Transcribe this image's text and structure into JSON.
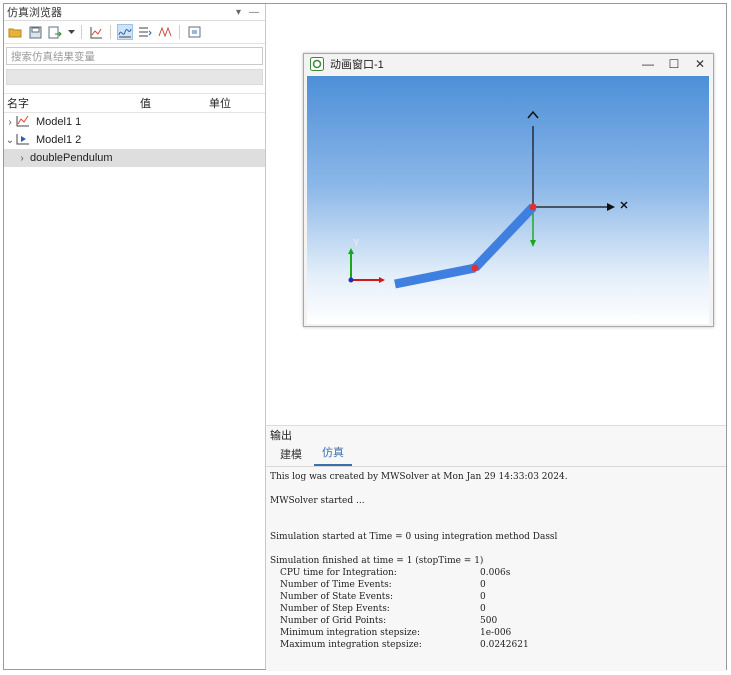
{
  "browser": {
    "title": "仿真浏览器",
    "title_controls": [
      "▾",
      "—"
    ],
    "search_placeholder": "搜索仿真结果变量",
    "columns": [
      "名字",
      "值",
      "单位"
    ],
    "tree": [
      {
        "expander": "›",
        "label": "Model1 1"
      },
      {
        "expander": "⌄",
        "label": "Model1 2"
      },
      {
        "expander": "›",
        "label": "doublePendulum"
      }
    ]
  },
  "anim_window": {
    "title": "动画窗口-1",
    "controls": [
      "—",
      "☐",
      "✕"
    ],
    "axis_labels": {
      "x": "X",
      "y": "Y"
    },
    "colors": {
      "link": "#3f7fe0",
      "joint": "#e03030",
      "x_axis": "#d01818",
      "y_axis": "#18a818"
    }
  },
  "output": {
    "title": "输出",
    "tabs": [
      "建模",
      "仿真"
    ],
    "active_tab": "仿真",
    "log_lines": {
      "created": "This log was created by MWSolver at Mon Jan 29 14:33:03 2024.",
      "started": "MWSolver started ...",
      "sim_start": "Simulation started at Time = 0 using integration method Dassl",
      "sim_finish": "Simulation finished at time = 1 (stopTime = 1)"
    },
    "stats": [
      {
        "key": "CPU time for Integration:",
        "value": "0.006s"
      },
      {
        "key": "Number of Time Events:",
        "value": "0"
      },
      {
        "key": "Number of State Events:",
        "value": "0"
      },
      {
        "key": "Number of Step Events:",
        "value": "0"
      },
      {
        "key": "Number of Grid Points:",
        "value": "500"
      },
      {
        "key": "Minimum integration stepsize:",
        "value": "1e-006"
      },
      {
        "key": "Maximum integration stepsize:",
        "value": "0.0242621"
      }
    ]
  }
}
